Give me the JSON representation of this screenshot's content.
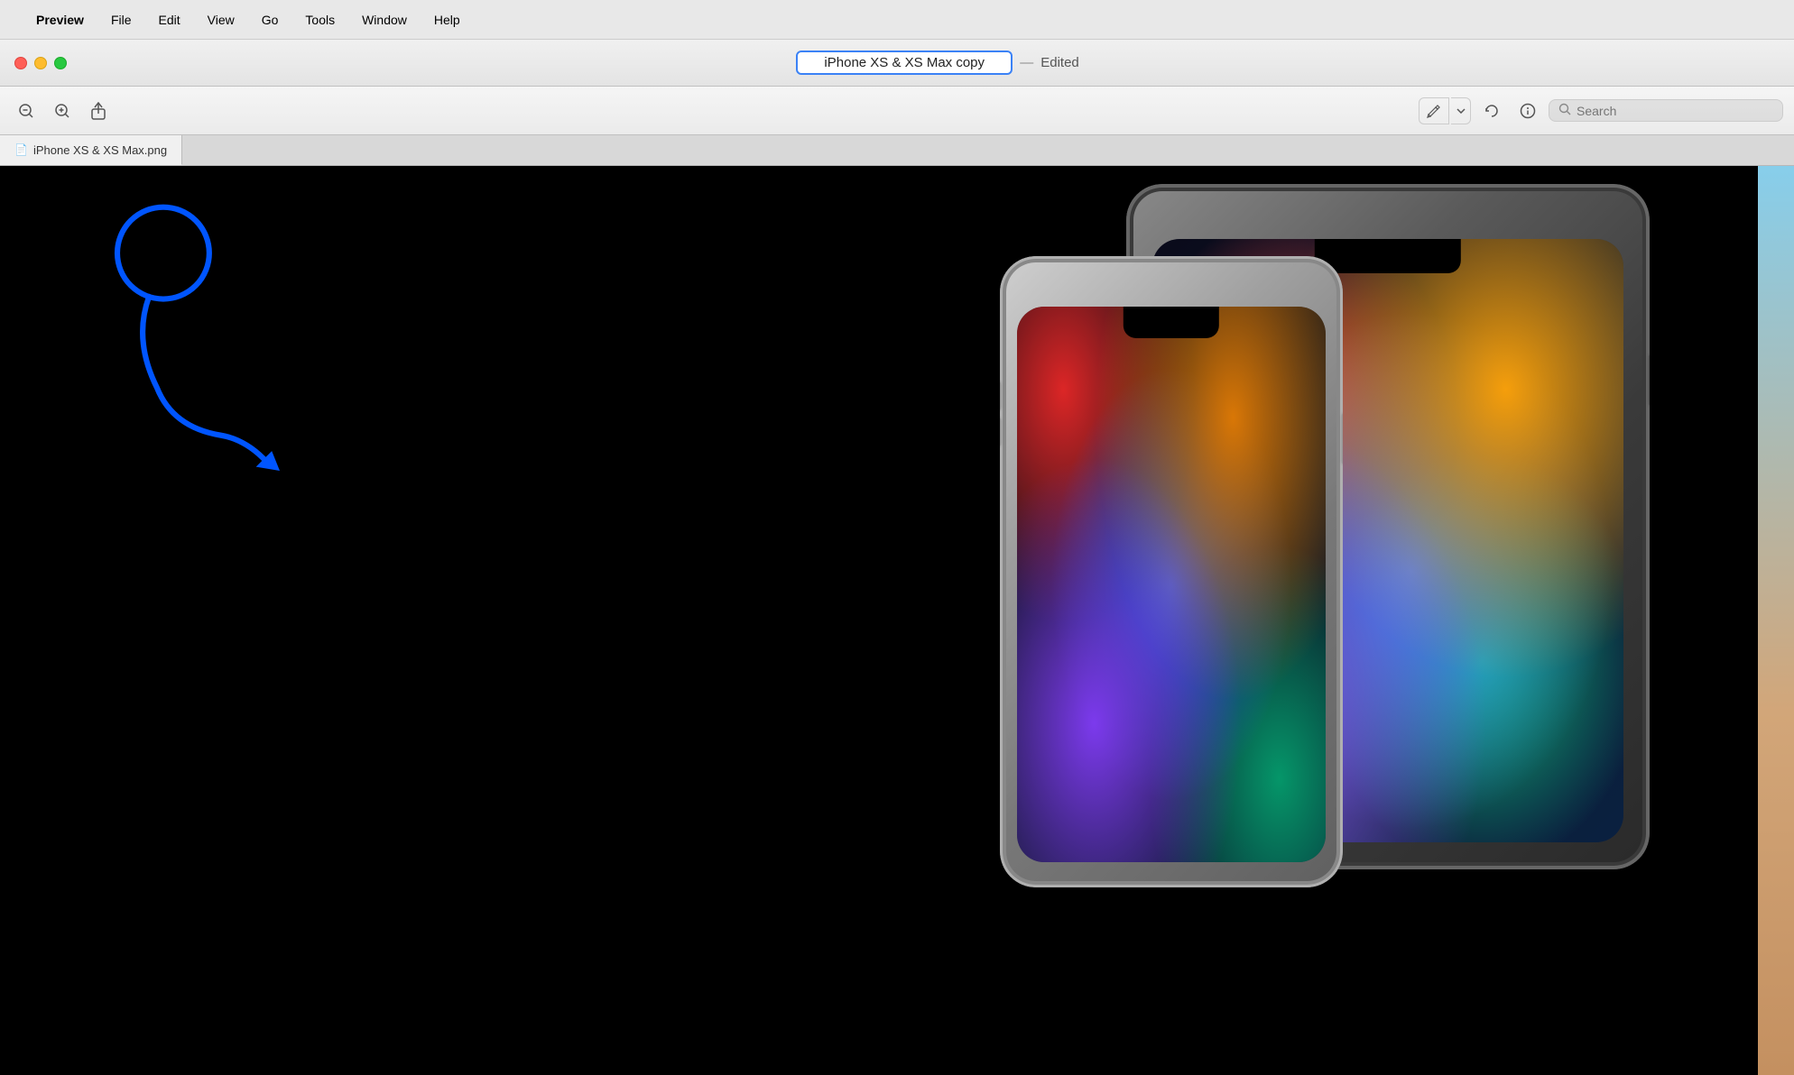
{
  "menubar": {
    "apple_symbol": "",
    "items": [
      {
        "id": "preview",
        "label": "Preview",
        "bold": true
      },
      {
        "id": "file",
        "label": "File"
      },
      {
        "id": "edit",
        "label": "Edit"
      },
      {
        "id": "view",
        "label": "View"
      },
      {
        "id": "go",
        "label": "Go"
      },
      {
        "id": "tools",
        "label": "Tools"
      },
      {
        "id": "window",
        "label": "Window"
      },
      {
        "id": "help",
        "label": "Help"
      }
    ]
  },
  "titlebar": {
    "window_title": "iPhone XS & XS Max copy",
    "edited_label": "Edited",
    "separator": "—"
  },
  "toolbar": {
    "zoom_out_label": "−",
    "zoom_in_label": "+",
    "share_label": "↑",
    "pencil_label": "✏",
    "rotate_label": "⟳",
    "spotlight_label": "◎",
    "search_placeholder": "Search"
  },
  "tabs": [
    {
      "id": "tab-1",
      "icon": "📄",
      "label": "iPhone XS & XS Max.png",
      "active": true
    }
  ],
  "content": {
    "bg_color": "#000000",
    "description": "iPhone XS and XS Max product photo on black background"
  },
  "annotations": {
    "circle_color": "#0055ff",
    "arrow_color": "#0055ff",
    "circle_description": "Blue circle around traffic light buttons",
    "arrow_description": "Blue arrow pointing to traffic light area"
  }
}
